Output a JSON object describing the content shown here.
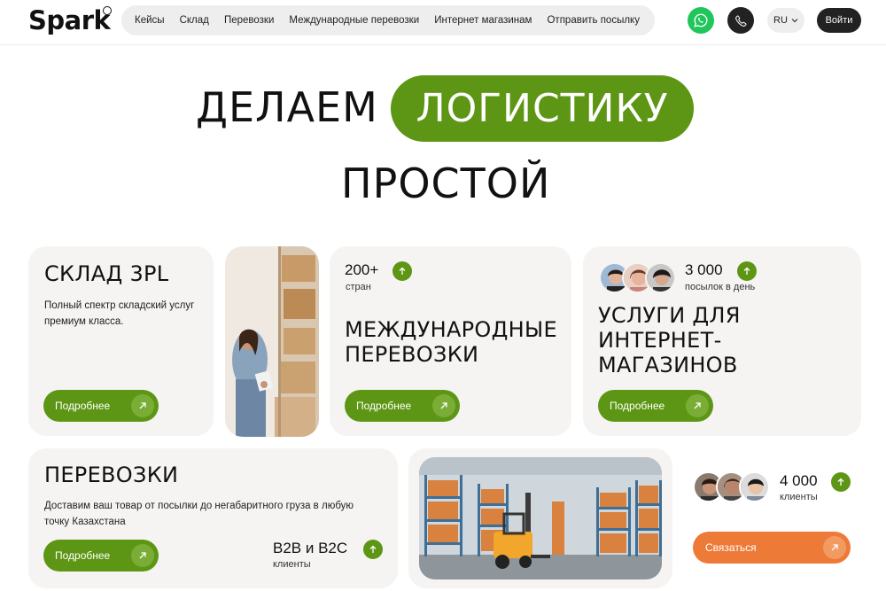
{
  "header": {
    "logo": "Spark",
    "nav": [
      "Кейсы",
      "Склад",
      "Перевозки",
      "Международные перевозки",
      "Интернет магазинам",
      "Отправить посылку"
    ],
    "lang": "RU",
    "login": "Войти"
  },
  "hero": {
    "word1": "ДЕЛАЕМ",
    "highlight": "ЛОГИСТИКУ",
    "word3": "ПРОСТОЙ"
  },
  "cards": {
    "warehouse": {
      "title": "СКЛАД 3PL",
      "desc": "Полный спектр складский услуг премиум класса.",
      "button": "Подробнее"
    },
    "international": {
      "stat_value": "200+",
      "stat_label": "стран",
      "title_line1": "МЕЖДУНАРОДНЫЕ",
      "title_line2": "ПЕРЕВОЗКИ",
      "button": "Подробнее"
    },
    "ecommerce": {
      "stat_value": "3 000",
      "stat_label": "посылок в день",
      "title_line1": "УСЛУГИ ДЛЯ",
      "title_line2": "ИНТЕРНЕТ-",
      "title_line3": "МАГАЗИНОВ",
      "button": "Подробнее"
    },
    "transport": {
      "title": "ПЕРЕВОЗКИ",
      "desc_line1": "Доставим ваш товар от посылки до негабаритного груза в любую",
      "desc_line2": "точку Казахстана",
      "button": "Подробнее",
      "stat_value": "B2B и B2C",
      "stat_label": "клиенты"
    },
    "clients": {
      "stat_value": "4 000",
      "stat_label": "клиенты",
      "button": "Связаться"
    }
  },
  "colors": {
    "accent_green": "#5d9614",
    "accent_orange": "#ee7a38",
    "whatsapp_green": "#20c65b",
    "card_bg": "#f5f4f2"
  },
  "icons": [
    "whatsapp-icon",
    "phone-icon",
    "chevron-down-icon",
    "arrow-up-right-icon",
    "arrow-up-icon"
  ]
}
